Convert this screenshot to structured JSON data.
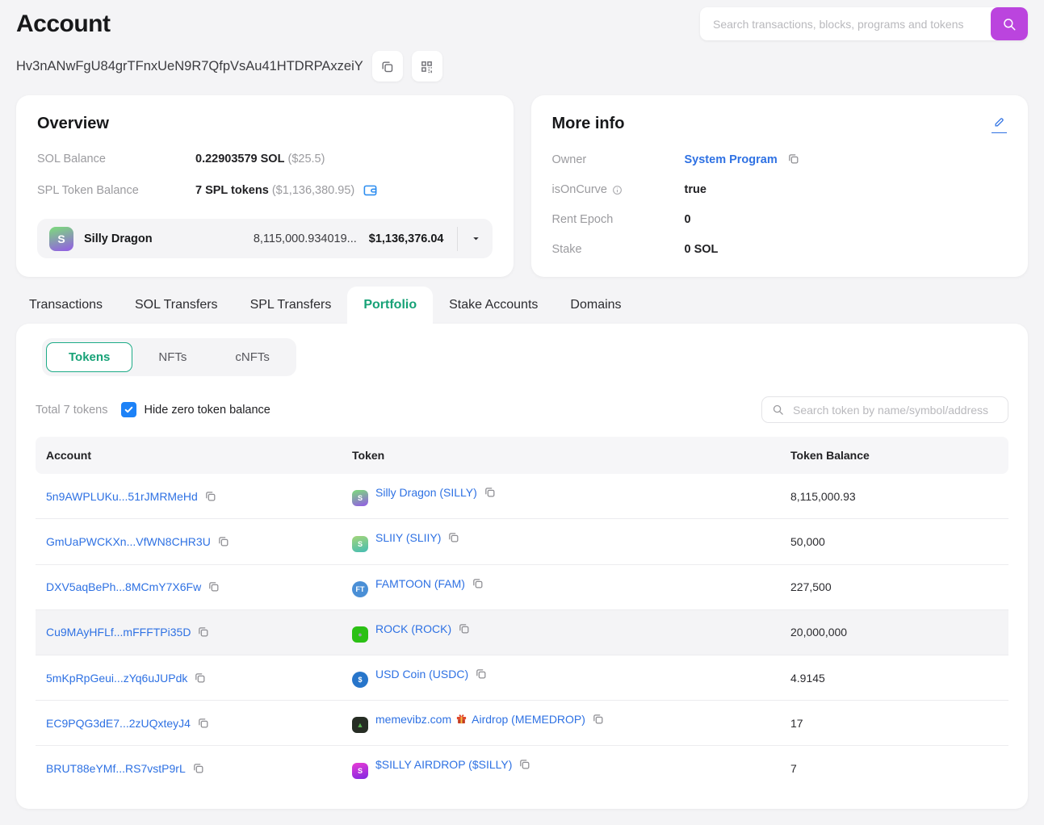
{
  "header": {
    "title": "Account",
    "address": "Hv3nANwFgU84grTFnxUeN9R7QfpVsAu41HTDRPAxzeiY",
    "search_placeholder": "Search transactions, blocks, programs and tokens"
  },
  "colors": {
    "accent_purple": "#bb44de",
    "link_blue": "#2e71e3",
    "active_green": "#17a277",
    "checkbox_blue": "#1d82f7",
    "wallet_icon_blue": "#2e8ef0"
  },
  "overview": {
    "title": "Overview",
    "sol_balance": {
      "label": "SOL Balance",
      "value": "0.22903579 SOL",
      "usd": "($25.5)"
    },
    "spl_balance": {
      "label": "SPL Token Balance",
      "value": "7 SPL tokens",
      "usd": "($1,136,380.95)"
    },
    "token_selector": {
      "name": "Silly Dragon",
      "amount": "8,115,000.934019...",
      "usd_value": "$1,136,376.04",
      "icon_bg": "linear-gradient(165deg,#7ed184 10%,#9166dd 90%)",
      "icon_glyph": "S"
    }
  },
  "more_info": {
    "title": "More info",
    "owner": {
      "label": "Owner",
      "value": "System Program"
    },
    "is_on_curve": {
      "label": "isOnCurve",
      "value": "true"
    },
    "rent_epoch": {
      "label": "Rent Epoch",
      "value": "0"
    },
    "stake": {
      "label": "Stake",
      "value": "0 SOL"
    }
  },
  "tabs": [
    {
      "label": "Transactions",
      "active": false
    },
    {
      "label": "SOL Transfers",
      "active": false
    },
    {
      "label": "SPL Transfers",
      "active": false
    },
    {
      "label": "Portfolio",
      "active": true
    },
    {
      "label": "Stake Accounts",
      "active": false
    },
    {
      "label": "Domains",
      "active": false
    }
  ],
  "portfolio": {
    "subtabs": [
      {
        "label": "Tokens",
        "active": true
      },
      {
        "label": "NFTs",
        "active": false
      },
      {
        "label": "cNFTs",
        "active": false
      }
    ],
    "total_text": "Total 7 tokens",
    "hide_zero": {
      "label": "Hide zero token balance",
      "checked": true
    },
    "search_placeholder": "Search token by name/symbol/address",
    "table": {
      "columns": [
        "Account",
        "Token",
        "Token Balance"
      ],
      "rows": [
        {
          "account": "5n9AWPLUKu...51rJMRMeHd",
          "token": "Silly Dragon (SILLY)",
          "balance": "8,115,000.93",
          "icon": {
            "name": "silly-dragon-token-icon",
            "glyph": "S",
            "bg": "linear-gradient(165deg,#7ed184 10%,#9166dd 90%)",
            "shape": "rounded"
          }
        },
        {
          "account": "GmUaPWCKXn...VfWN8CHR3U",
          "token": "SLIIY (SLIIY)",
          "balance": "50,000",
          "icon": {
            "name": "sliiy-token-icon",
            "glyph": "S",
            "bg": "linear-gradient(165deg,#9bd37e 10%,#4fbfae 90%)",
            "shape": "rounded"
          }
        },
        {
          "account": "DXV5aqBePh...8MCmY7X6Fw",
          "token": "FAMTOON (FAM)",
          "balance": "227,500",
          "icon": {
            "name": "famtoon-token-icon",
            "glyph": "FT",
            "bg": "#4a8fd6",
            "shape": "circle"
          }
        },
        {
          "account": "Cu9MAyHFLf...mFFFTPi35D",
          "token": "ROCK (ROCK)",
          "balance": "20,000,000",
          "highlight": true,
          "icon": {
            "name": "rock-token-icon",
            "glyph": "●",
            "glyph_color": "#9aa3ab",
            "bg": "#2bc015",
            "shape": "rounded"
          }
        },
        {
          "account": "5mKpRpGeui...zYq6uJUPdk",
          "token": "USD Coin (USDC)",
          "balance": "4.9145",
          "icon": {
            "name": "usdc-token-icon",
            "glyph": "$",
            "bg": "#2775ca",
            "shape": "circle"
          }
        },
        {
          "account": "EC9PQG3dE7...2zUQxteyJ4",
          "token_prefix": "memevibz.com",
          "token_suffix": "Airdrop (MEMEDROP)",
          "balance": "17",
          "icon": {
            "name": "memedrop-token-icon",
            "glyph": "▲",
            "glyph_color": "#56b14e",
            "bg": "#262d24",
            "shape": "rounded"
          }
        },
        {
          "account": "BRUT88eYMf...RS7vstP9rL",
          "token": "$SILLY AIRDROP ($SILLY)",
          "balance": "7",
          "icon": {
            "name": "silly-airdrop-token-icon",
            "glyph": "S",
            "bg": "linear-gradient(165deg,#e03ad6 10%,#8b2be0 90%)",
            "shape": "rounded"
          }
        }
      ]
    }
  }
}
